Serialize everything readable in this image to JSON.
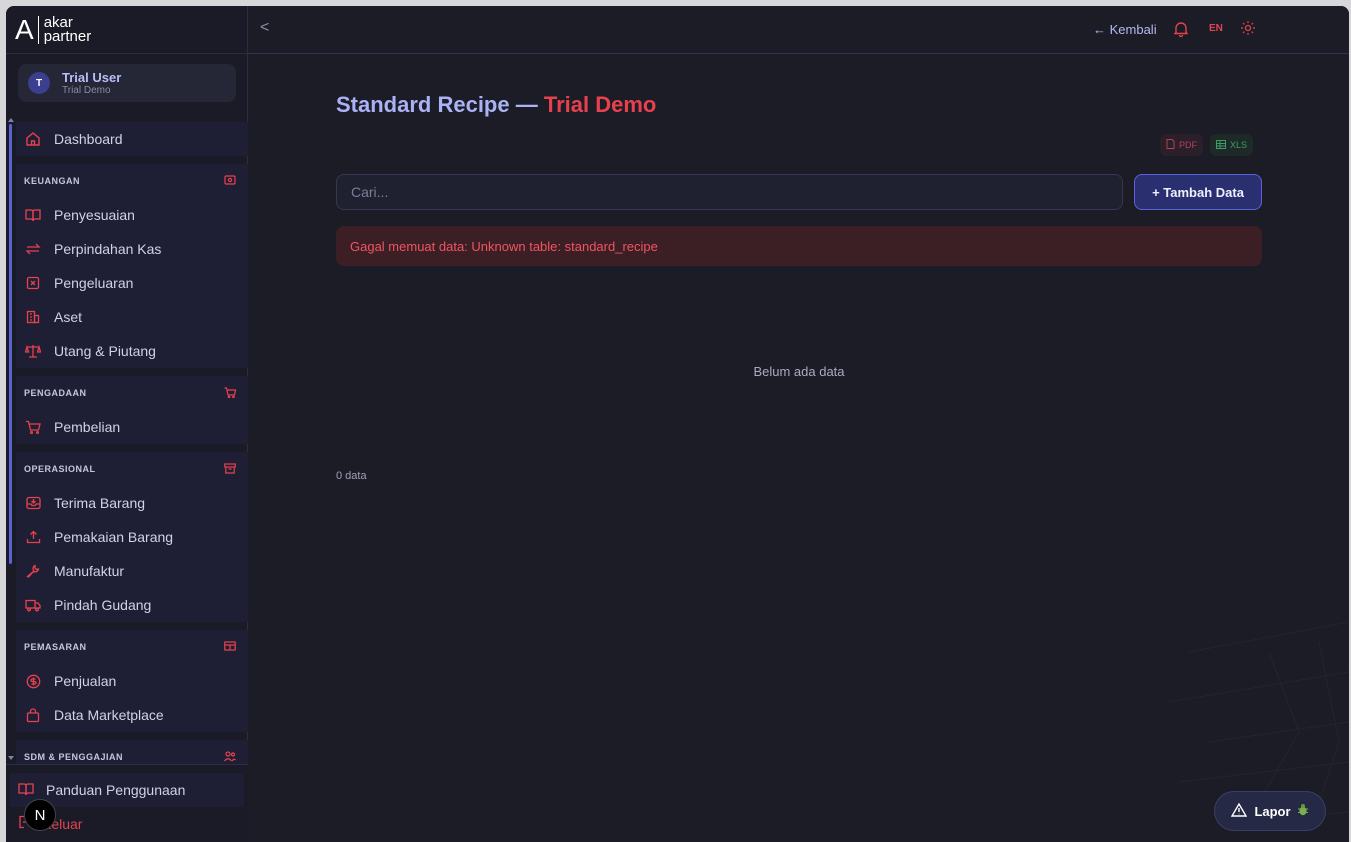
{
  "brand": {
    "logo_letter": "A",
    "line1": "akar",
    "line2": "partner"
  },
  "user": {
    "initial": "T",
    "name": "Trial User",
    "sub": "Trial Demo"
  },
  "sidebar": {
    "dashboard": "Dashboard",
    "sections": [
      {
        "title": "KEUANGAN",
        "icon": "money-icon",
        "items": [
          {
            "label": "Penyesuaian",
            "icon": "book-icon"
          },
          {
            "label": "Perpindahan Kas",
            "icon": "transfer-icon"
          },
          {
            "label": "Pengeluaran",
            "icon": "receipt-icon"
          },
          {
            "label": "Aset",
            "icon": "building-icon"
          },
          {
            "label": "Utang & Piutang",
            "icon": "scale-icon"
          }
        ]
      },
      {
        "title": "PENGADAAN",
        "icon": "cart-icon",
        "items": [
          {
            "label": "Pembelian",
            "icon": "cart-icon"
          }
        ]
      },
      {
        "title": "OPERASIONAL",
        "icon": "archive-icon",
        "items": [
          {
            "label": "Terima Barang",
            "icon": "inbox-icon"
          },
          {
            "label": "Pemakaian Barang",
            "icon": "upload-icon"
          },
          {
            "label": "Manufaktur",
            "icon": "wrench-icon"
          },
          {
            "label": "Pindah Gudang",
            "icon": "truck-icon"
          }
        ]
      },
      {
        "title": "PEMASARAN",
        "icon": "store-icon",
        "items": [
          {
            "label": "Penjualan",
            "icon": "dollar-icon"
          },
          {
            "label": "Data Marketplace",
            "icon": "bag-icon"
          }
        ]
      },
      {
        "title": "SDM & PENGGAJIAN",
        "icon": "users-icon",
        "items": []
      }
    ],
    "guide": "Panduan Penggunaan",
    "logout": "Keluar"
  },
  "topbar": {
    "collapse": "<",
    "back": "← Kembali",
    "lang": "EN"
  },
  "main": {
    "title": "Standard Recipe — ",
    "title_accent": "Trial Demo",
    "export_pdf": "PDF",
    "export_xls": "XLS",
    "search_placeholder": "Cari...",
    "add_button": "+ Tambah Data",
    "error": "Gagal memuat data: Unknown table: standard_recipe",
    "empty": "Belum ada data",
    "count": "0 data"
  },
  "report": {
    "label": "Lapor"
  },
  "next_badge": "N",
  "colors": {
    "accent": "#e8414e",
    "primary": "#5a62d9",
    "bg": "#1b1c26"
  }
}
